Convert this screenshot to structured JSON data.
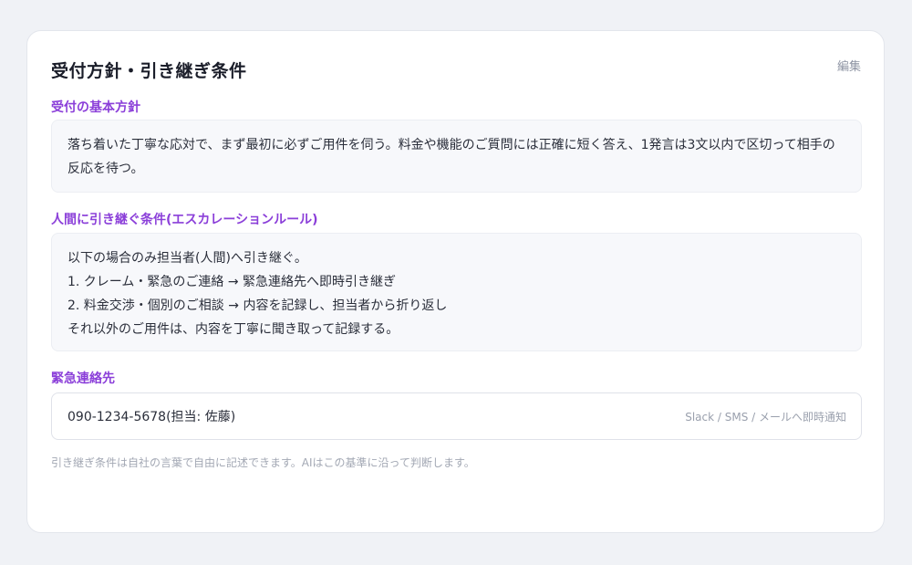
{
  "card": {
    "title": "受付方針・引き継ぎ条件",
    "edit_label": "編集"
  },
  "policy": {
    "label": "受付の基本方針",
    "text": "落ち着いた丁寧な応対で、まず最初に必ずご用件を伺う。料金や機能のご質問には正確に短く答え、1発言は3文以内で区切って相手の反応を待つ。"
  },
  "escalation": {
    "label": "人間に引き継ぐ条件(エスカレーションルール)",
    "lines": [
      "以下の場合のみ担当者(人間)へ引き継ぐ。",
      "1. クレーム・緊急のご連絡 → 緊急連絡先へ即時引き継ぎ",
      "2. 料金交渉・個別のご相談 → 内容を記録し、担当者から折り返し",
      "それ以外のご用件は、内容を丁寧に聞き取って記録する。"
    ]
  },
  "emergency": {
    "label": "緊急連絡先",
    "value": "090-1234-5678(担当: 佐藤)",
    "hint": "Slack / SMS / メールへ即時通知"
  },
  "footnote": "引き継ぎ条件は自社の言葉で自由に記述できます。AIはこの基準に沿って判断します。",
  "colors": {
    "accent": "#8b3fd9",
    "background": "#f0f2f6",
    "card": "#ffffff",
    "box": "#f7f8fb"
  }
}
